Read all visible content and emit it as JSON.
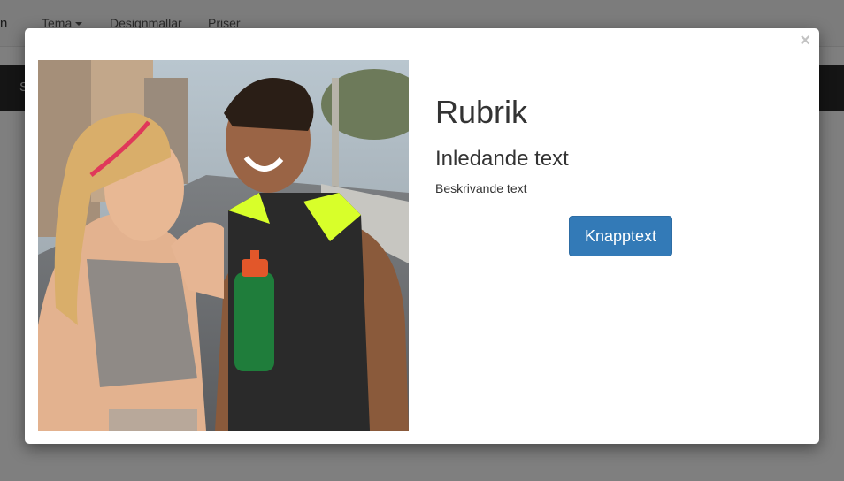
{
  "background": {
    "brand_fragment": "n",
    "nav": [
      {
        "label": "Tema"
      },
      {
        "label": "Designmallar"
      },
      {
        "label": "Priser"
      }
    ],
    "darkbar_fragment": "S"
  },
  "modal": {
    "close_glyph": "×",
    "image_icon": "photo-couple-fitness",
    "title": "Rubrik",
    "subtitle": "Inledande text",
    "description": "Beskrivande text",
    "button_label": "Knapptext",
    "button_color": "#337ab7"
  }
}
